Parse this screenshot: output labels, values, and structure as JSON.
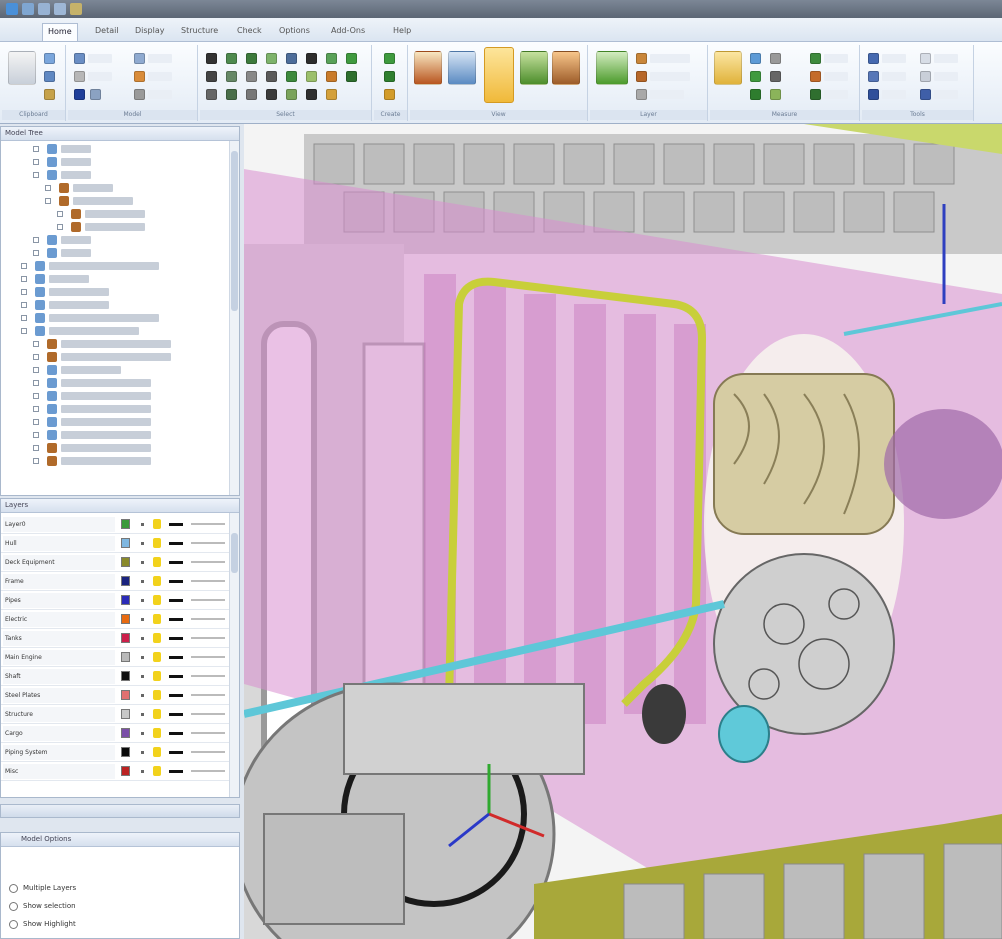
{
  "ribbon": {
    "tabs": [
      {
        "label": "Home",
        "active": true
      },
      {
        "label": "Detail",
        "active": false
      },
      {
        "label": "Display",
        "active": false
      },
      {
        "label": "Structure",
        "active": false
      },
      {
        "label": "Check",
        "active": false
      },
      {
        "label": "Options",
        "active": false
      },
      {
        "label": "Add-Ons",
        "active": false
      },
      {
        "label": "Help",
        "active": false
      }
    ],
    "groups": [
      "Clipboard",
      "Model",
      "Select",
      "Create",
      "View",
      "Layer",
      "Measure",
      "Tools"
    ]
  },
  "model_tree": {
    "header": "Model Tree"
  },
  "layers": {
    "header": "Layers",
    "rows": [
      {
        "name": "Layer0",
        "color": "#3a9a3a"
      },
      {
        "name": "Hull",
        "color": "#7fb7e0"
      },
      {
        "name": "Deck Equipment",
        "color": "#8a8a2a"
      },
      {
        "name": "Frame",
        "color": "#1a237e"
      },
      {
        "name": "Pipes",
        "color": "#2b2bb8"
      },
      {
        "name": "Electric",
        "color": "#e86a10"
      },
      {
        "name": "Tanks",
        "color": "#cc1f4a"
      },
      {
        "name": "Main Engine",
        "color": "#b9b9b9"
      },
      {
        "name": "Shaft",
        "color": "#111111"
      },
      {
        "name": "Steel Plates",
        "color": "#e07070"
      },
      {
        "name": "Structure",
        "color": "#c8c8c8"
      },
      {
        "name": "Cargo",
        "color": "#7b4fa8"
      },
      {
        "name": "Piping System",
        "color": "#0a0a0a"
      },
      {
        "name": "Misc",
        "color": "#bb2222"
      }
    ]
  },
  "options": {
    "header": "Model Options",
    "items": [
      "Multiple Layers",
      "Show selection",
      "Show Highlight"
    ]
  }
}
